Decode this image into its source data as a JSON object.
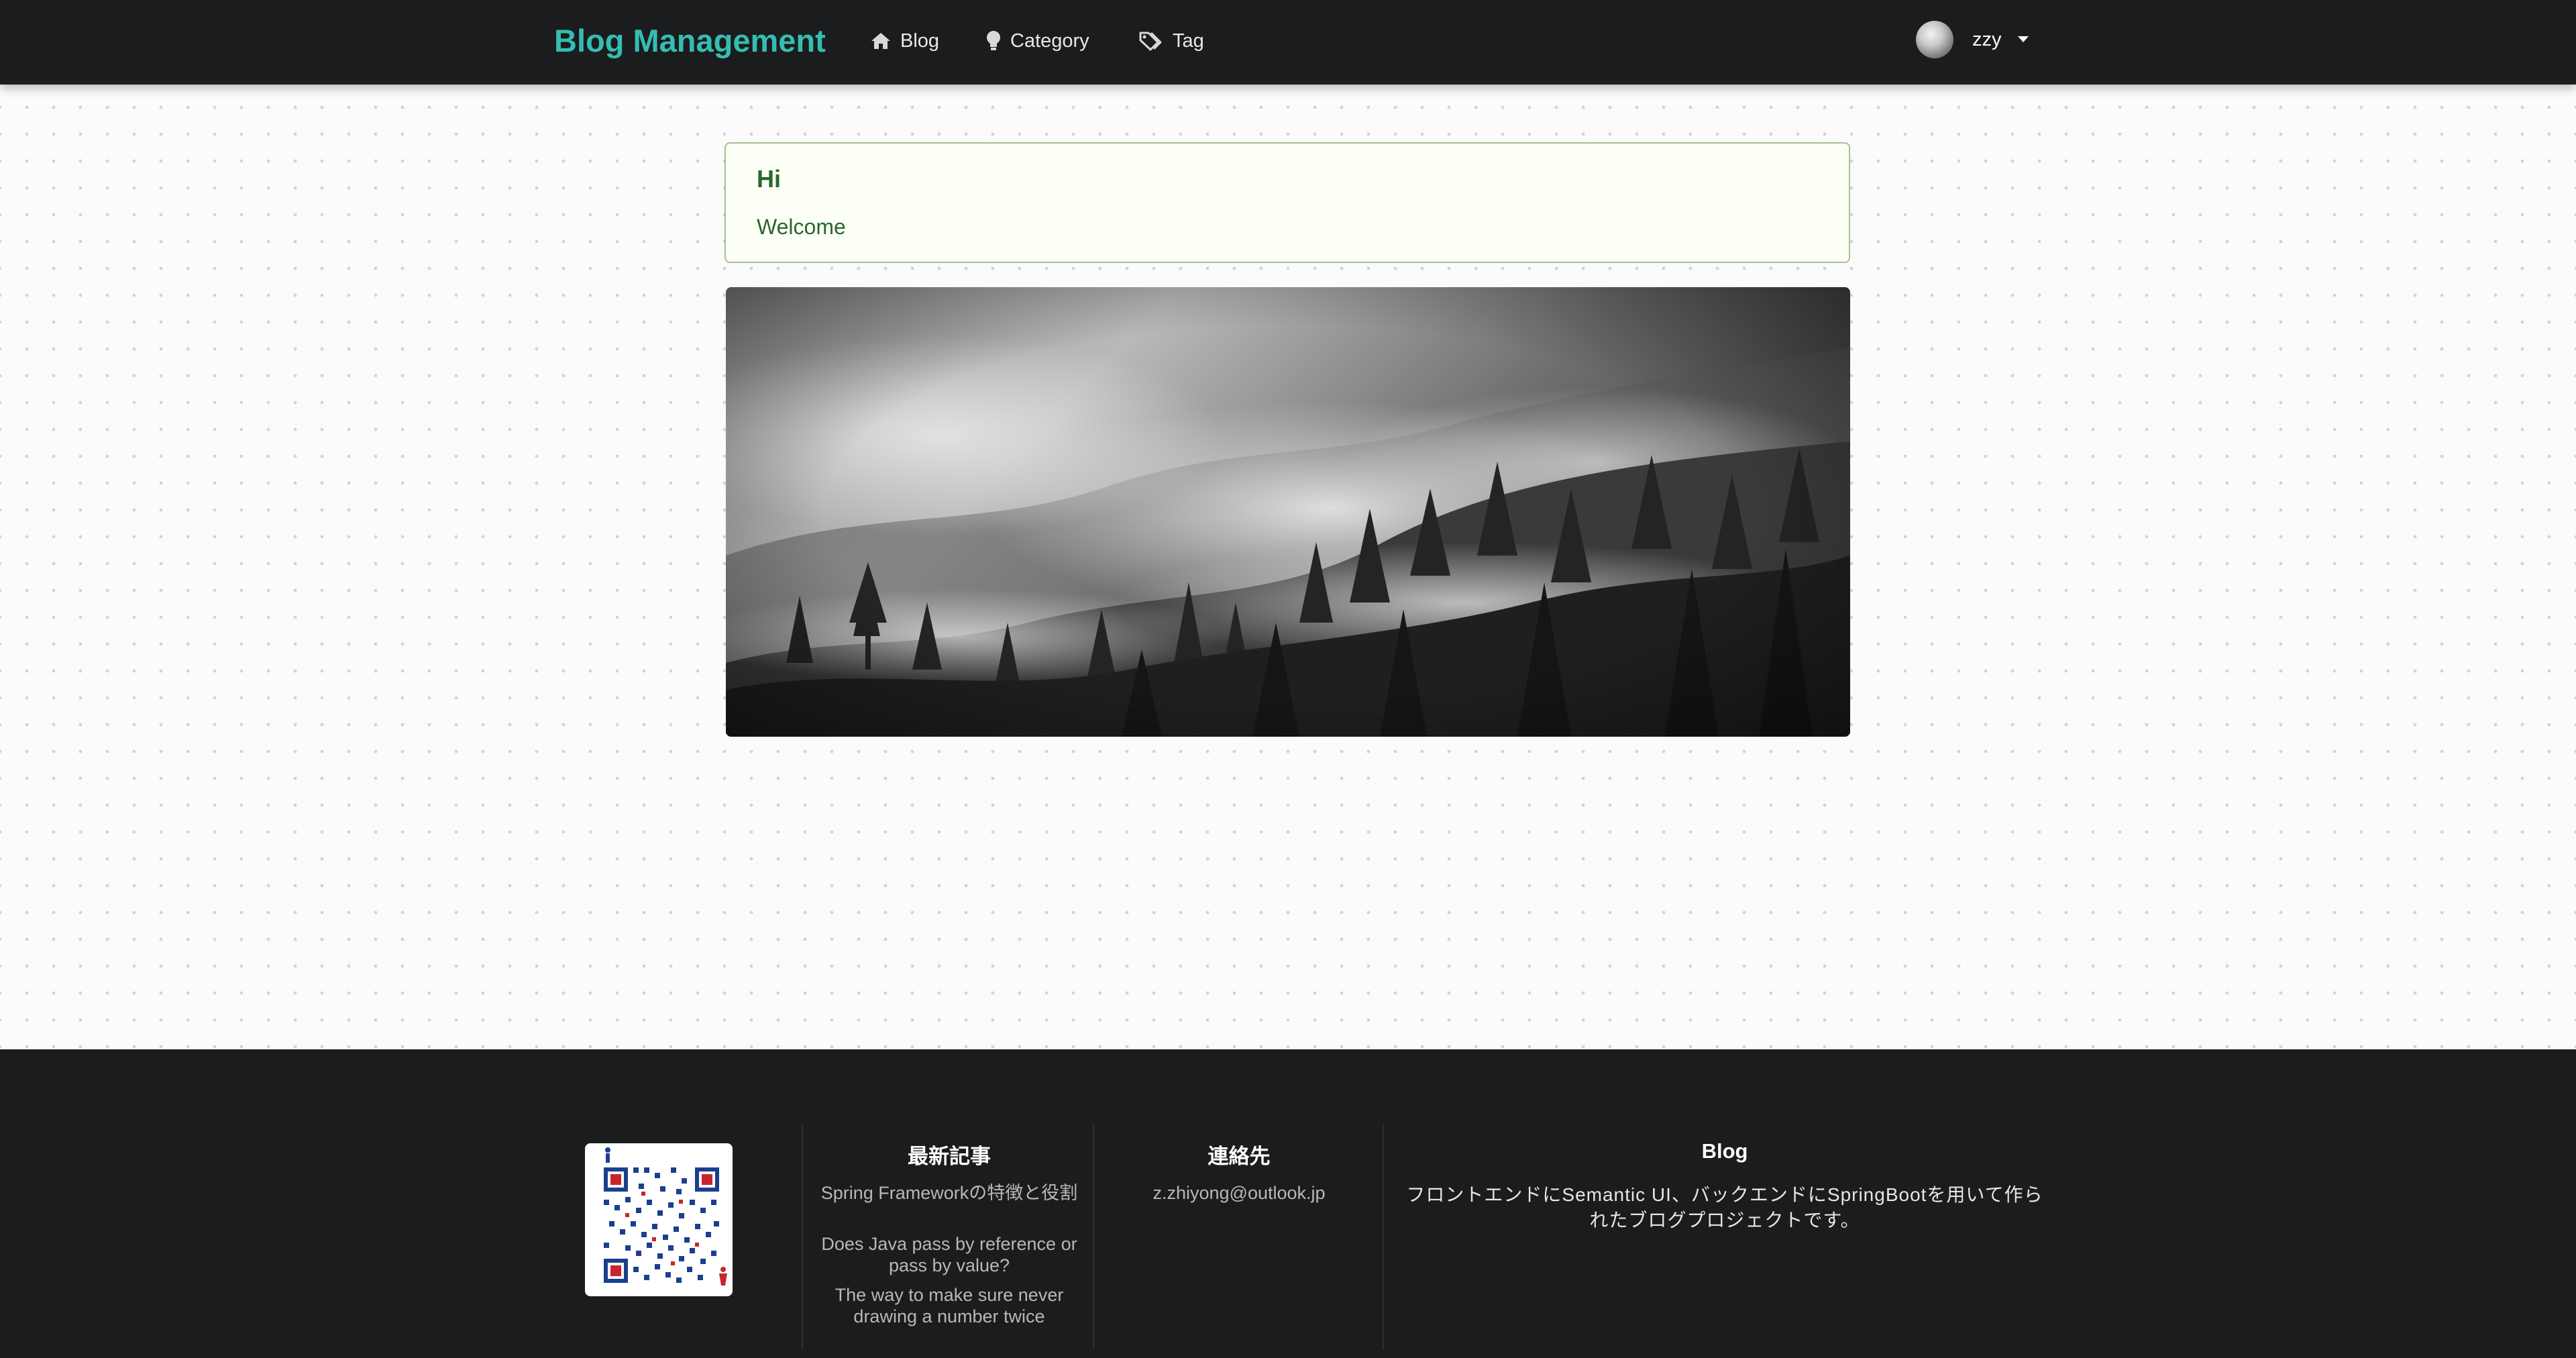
{
  "nav": {
    "brand": "Blog Management",
    "items": [
      {
        "label": "Blog",
        "icon": "home-icon"
      },
      {
        "label": "Category",
        "icon": "lightbulb-icon"
      },
      {
        "label": "Tag",
        "icon": "tags-icon"
      }
    ],
    "user": {
      "name": "zzy",
      "icon": "chevron-down-icon"
    }
  },
  "message": {
    "header": "Hi",
    "text": "Welcome"
  },
  "hero": {
    "alt": "foggy forest"
  },
  "footer": {
    "latest": {
      "title": "最新記事",
      "links": [
        "Spring Frameworkの特徴と役割",
        "Does Java pass by reference or pass by value?",
        "The way to make sure never drawing a number twice"
      ]
    },
    "contact": {
      "title": "連絡先",
      "email": "z.zhiyong@outlook.jp"
    },
    "about": {
      "title": "Blog",
      "text": "フロントエンドにSemantic UI、バックエンドにSpringBootを用いて作られたブログプロジェクトです。"
    }
  },
  "colors": {
    "brand": "#35bdb2",
    "navbar_bg": "#1b1c1d",
    "message_bg": "#fcfff5",
    "message_border": "#a3c293",
    "message_text": "#2c662d"
  }
}
